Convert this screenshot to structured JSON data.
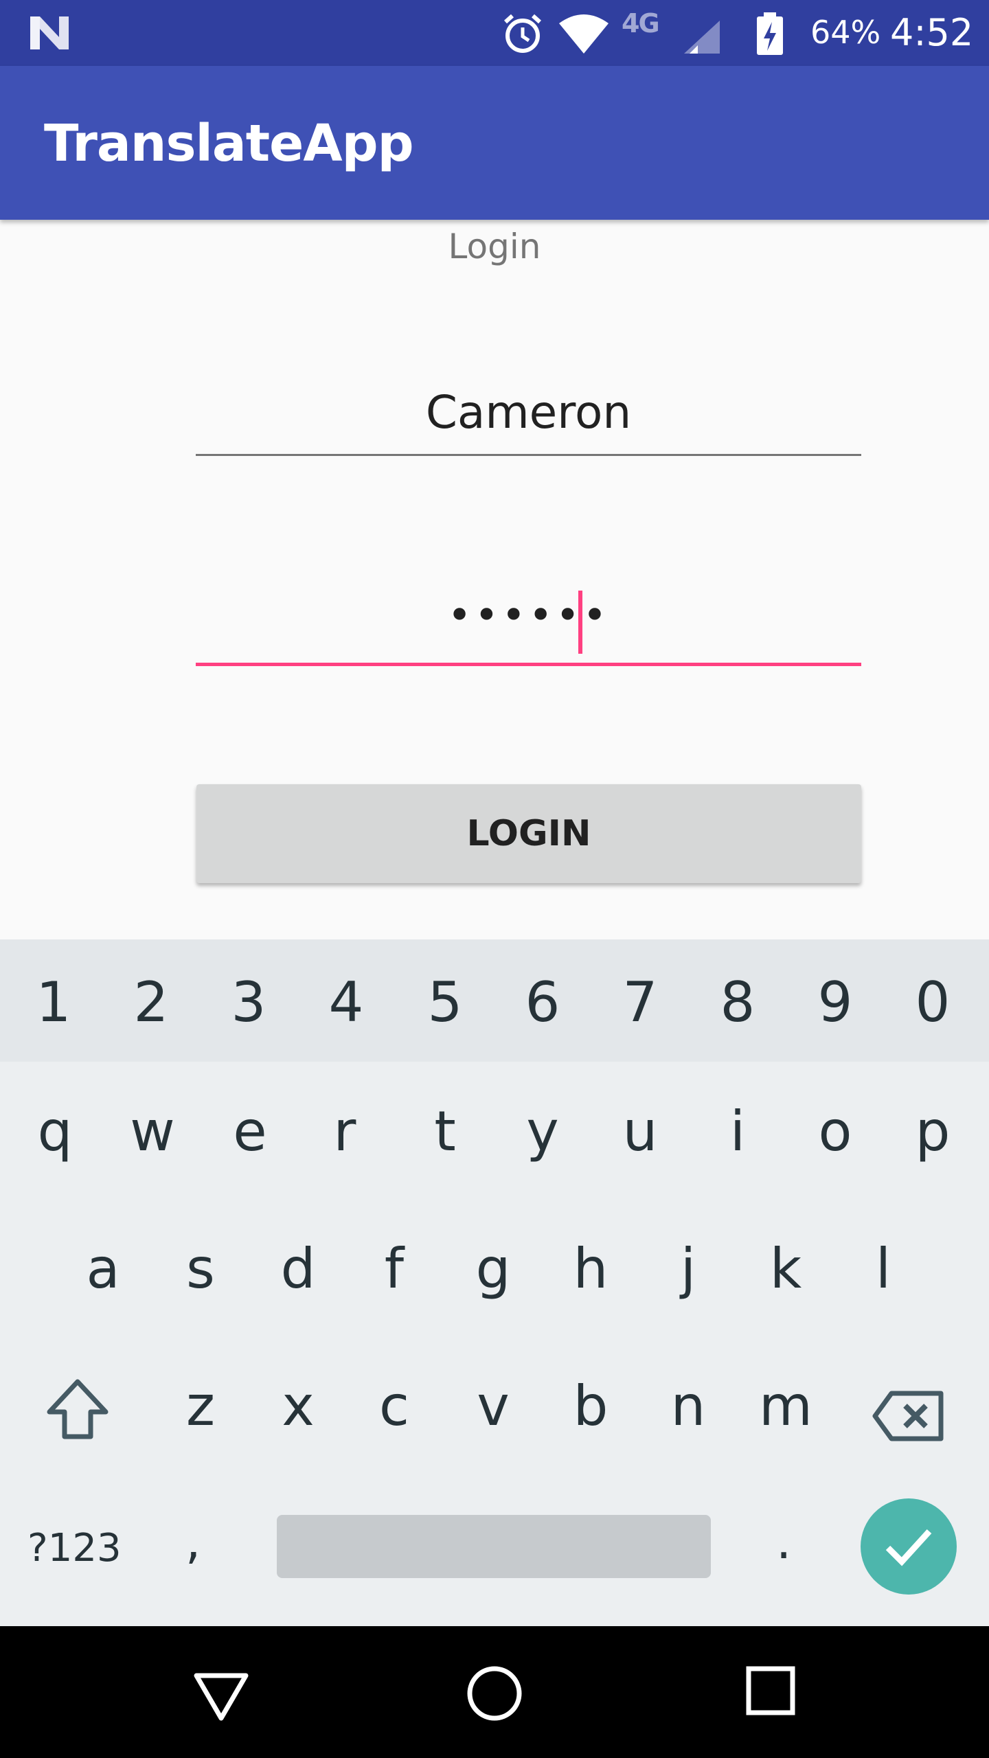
{
  "status_bar": {
    "network_label": "4G",
    "battery_percent": "64%",
    "time": "4:52",
    "icons": [
      "notification-n-icon",
      "alarm-icon",
      "wifi-icon",
      "cell-signal-icon",
      "battery-charging-icon"
    ]
  },
  "app_bar": {
    "title": "TranslateApp",
    "color": "#3f51b5",
    "status_color": "#303f9f"
  },
  "form": {
    "heading": "Login",
    "username_value": "Cameron",
    "password_value": "••••••",
    "login_label": "LOGIN",
    "accent_color": "#ff4081"
  },
  "keyboard": {
    "digits": [
      "1",
      "2",
      "3",
      "4",
      "5",
      "6",
      "7",
      "8",
      "9",
      "0"
    ],
    "row2": [
      "q",
      "w",
      "e",
      "r",
      "t",
      "y",
      "u",
      "i",
      "o",
      "p"
    ],
    "row3": [
      "a",
      "s",
      "d",
      "f",
      "g",
      "h",
      "j",
      "k",
      "l"
    ],
    "row4": [
      "z",
      "x",
      "c",
      "v",
      "b",
      "n",
      "m"
    ],
    "symbols_label": "?123",
    "comma": ",",
    "period": ".",
    "enter_color": "#4db6ac"
  },
  "nav_bar": {
    "icons": [
      "back-icon",
      "home-icon",
      "recents-icon"
    ]
  }
}
